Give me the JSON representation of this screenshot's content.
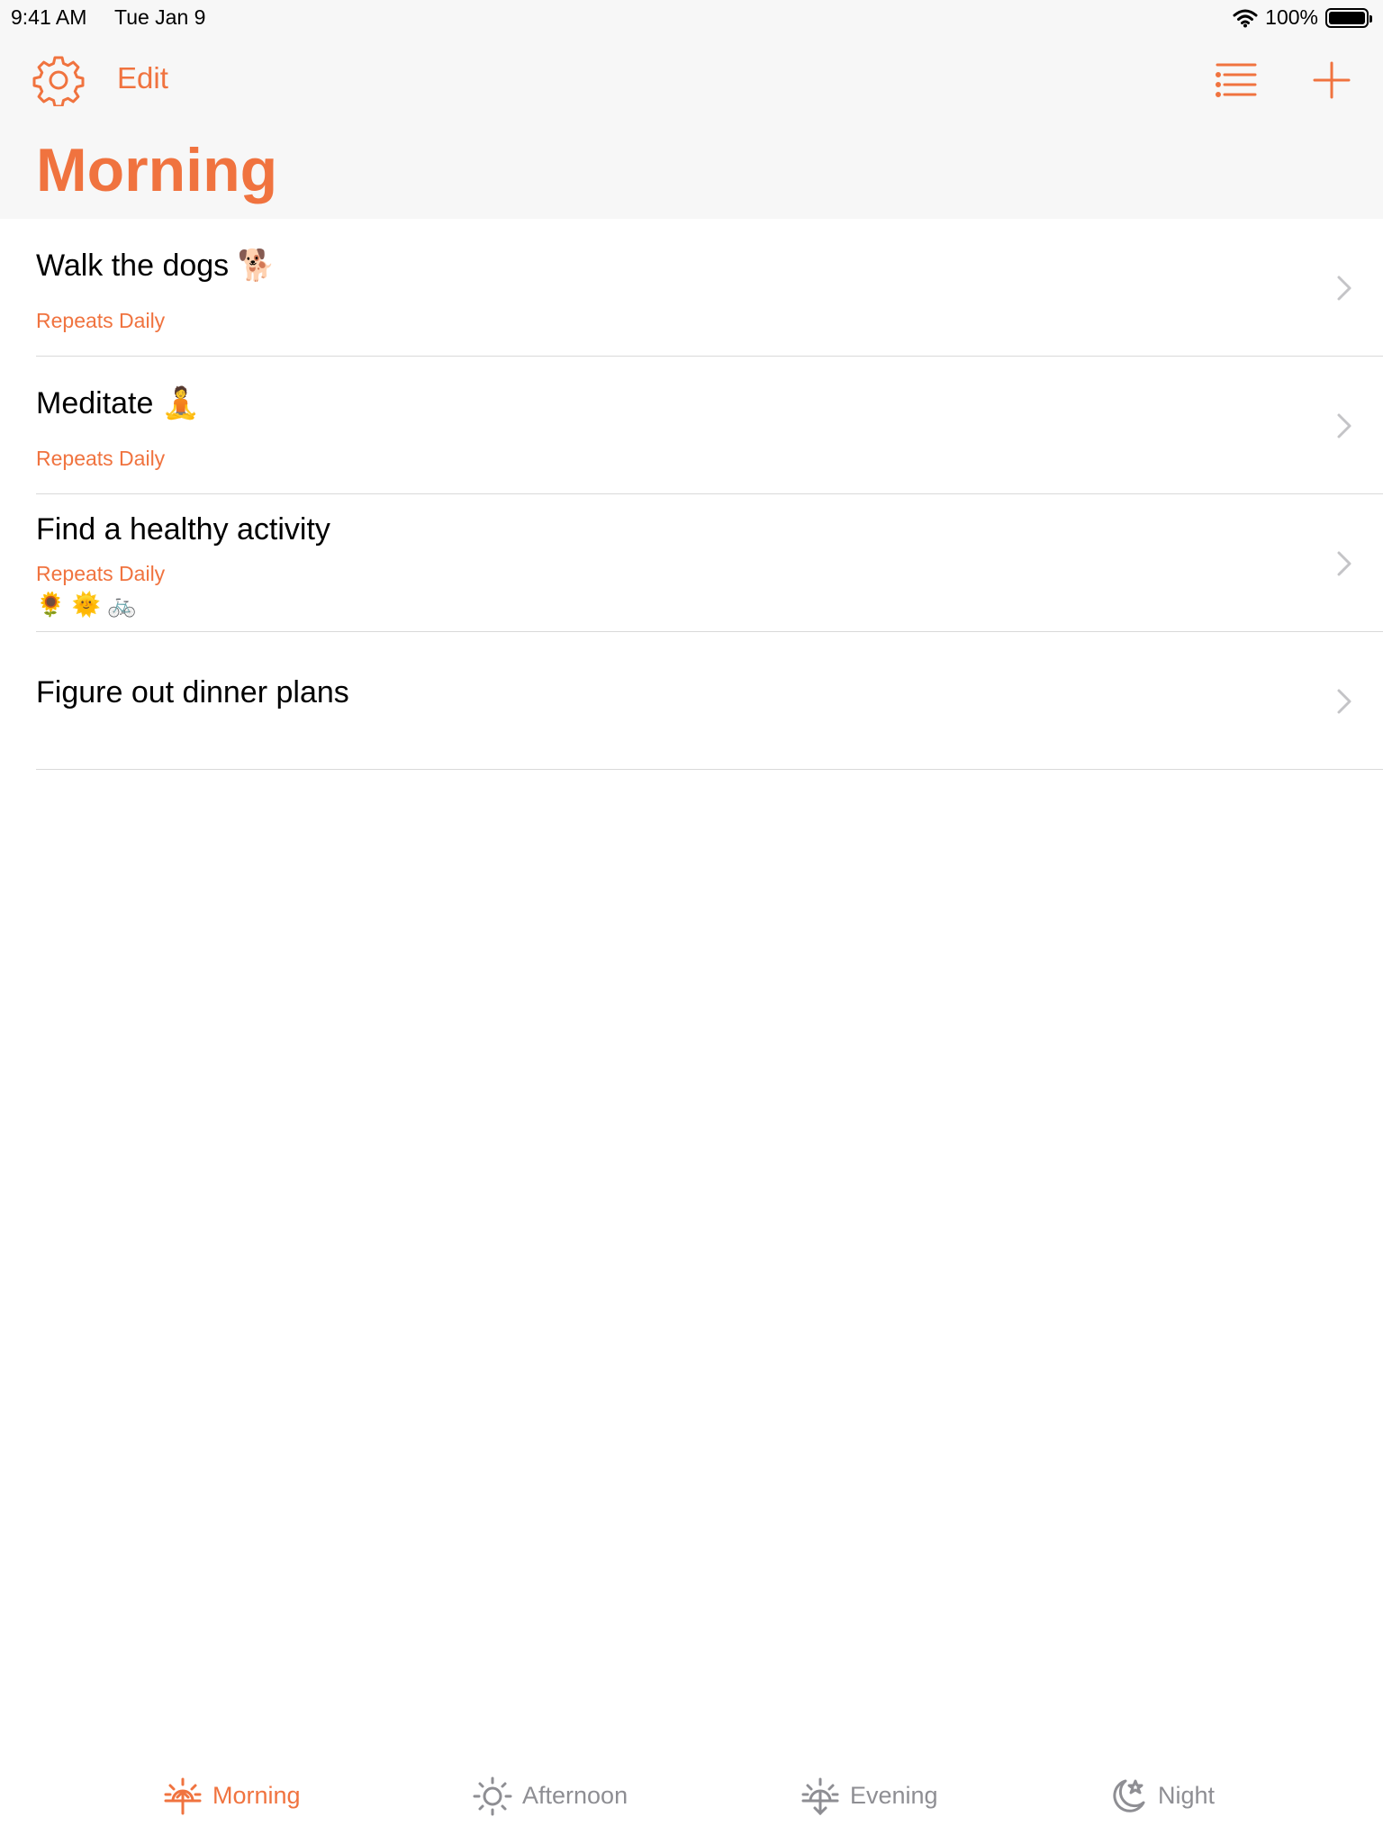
{
  "status_bar": {
    "time": "9:41 AM",
    "date": "Tue Jan 9",
    "battery": "100%"
  },
  "nav": {
    "edit_label": "Edit",
    "settings_icon": "gear-icon",
    "list_icon": "list-icon",
    "add_icon": "plus-icon"
  },
  "page": {
    "title": "Morning"
  },
  "tasks": [
    {
      "title": "Walk the dogs 🐕",
      "subtitle": "Repeats Daily",
      "emojis": ""
    },
    {
      "title": "Meditate 🧘",
      "subtitle": "Repeats Daily",
      "emojis": ""
    },
    {
      "title": "Find a healthy activity",
      "subtitle": "Repeats Daily",
      "emojis": "🌻 🌞 🚲"
    },
    {
      "title": "Figure out dinner plans",
      "subtitle": "",
      "emojis": ""
    }
  ],
  "tabs": [
    {
      "label": "Morning",
      "icon": "sunrise-icon",
      "active": true
    },
    {
      "label": "Afternoon",
      "icon": "sun-icon",
      "active": false
    },
    {
      "label": "Evening",
      "icon": "sunset-icon",
      "active": false
    },
    {
      "label": "Night",
      "icon": "moon-star-icon",
      "active": false
    }
  ],
  "colors": {
    "accent": "#f0733f",
    "inactive": "#8e8e93",
    "header_bg": "#f7f7f7",
    "separator": "#d9d9d9"
  }
}
